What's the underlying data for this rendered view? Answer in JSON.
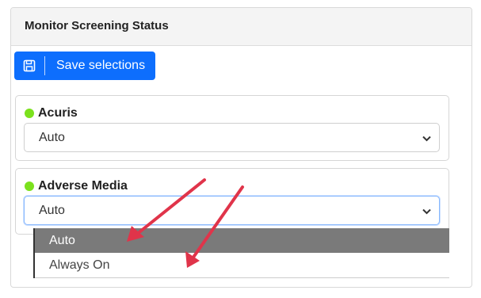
{
  "panel": {
    "title": "Monitor Screening Status"
  },
  "toolbar": {
    "save_label": "Save selections",
    "save_icon": "floppy-disk-icon"
  },
  "sources": [
    {
      "name": "Acuris",
      "status_color": "#7be11d",
      "selected": "Auto"
    },
    {
      "name": "Adverse Media",
      "status_color": "#7be11d",
      "selected": "Auto"
    }
  ],
  "dropdown": {
    "options": [
      "Auto",
      "Always On"
    ],
    "highlighted": "Auto"
  },
  "annotation": {
    "arrow_color": "#e0344a"
  }
}
